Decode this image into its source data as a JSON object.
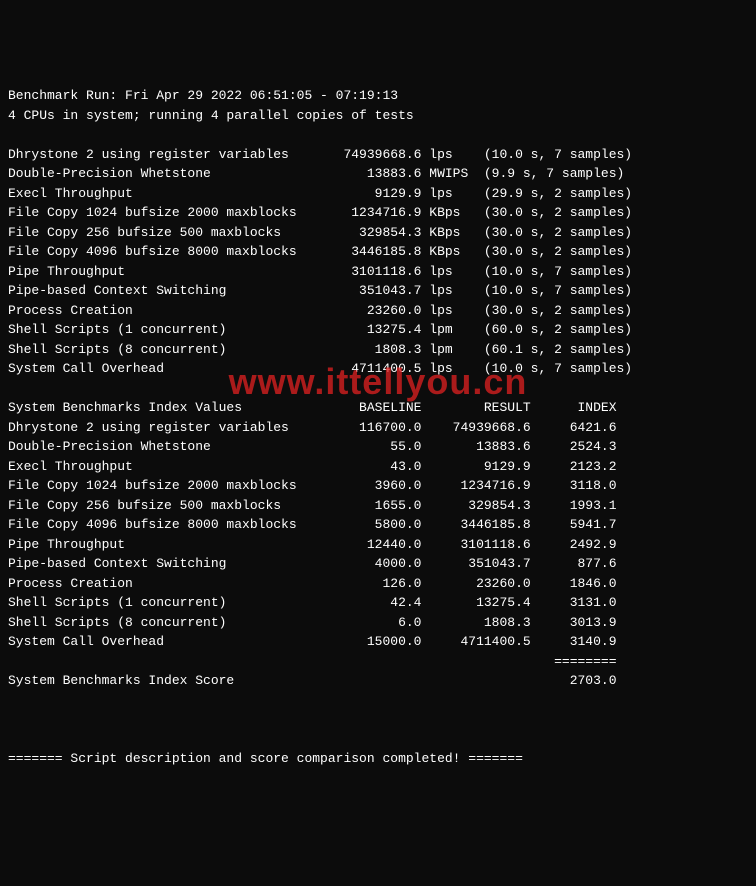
{
  "header": {
    "run_line": "Benchmark Run: Fri Apr 29 2022 06:51:05 - 07:19:13",
    "cpu_line": "4 CPUs in system; running 4 parallel copies of tests"
  },
  "raw": [
    {
      "name": "Dhrystone 2 using register variables",
      "value": "74939668.6",
      "unit": "lps",
      "time": "10.0",
      "samples": "7"
    },
    {
      "name": "Double-Precision Whetstone",
      "value": "13883.6",
      "unit": "MWIPS",
      "time": "9.9",
      "samples": "7"
    },
    {
      "name": "Execl Throughput",
      "value": "9129.9",
      "unit": "lps",
      "time": "29.9",
      "samples": "2"
    },
    {
      "name": "File Copy 1024 bufsize 2000 maxblocks",
      "value": "1234716.9",
      "unit": "KBps",
      "time": "30.0",
      "samples": "2"
    },
    {
      "name": "File Copy 256 bufsize 500 maxblocks",
      "value": "329854.3",
      "unit": "KBps",
      "time": "30.0",
      "samples": "2"
    },
    {
      "name": "File Copy 4096 bufsize 8000 maxblocks",
      "value": "3446185.8",
      "unit": "KBps",
      "time": "30.0",
      "samples": "2"
    },
    {
      "name": "Pipe Throughput",
      "value": "3101118.6",
      "unit": "lps",
      "time": "10.0",
      "samples": "7"
    },
    {
      "name": "Pipe-based Context Switching",
      "value": "351043.7",
      "unit": "lps",
      "time": "10.0",
      "samples": "7"
    },
    {
      "name": "Process Creation",
      "value": "23260.0",
      "unit": "lps",
      "time": "30.0",
      "samples": "2"
    },
    {
      "name": "Shell Scripts (1 concurrent)",
      "value": "13275.4",
      "unit": "lpm",
      "time": "60.0",
      "samples": "2"
    },
    {
      "name": "Shell Scripts (8 concurrent)",
      "value": "1808.3",
      "unit": "lpm",
      "time": "60.1",
      "samples": "2"
    },
    {
      "name": "System Call Overhead",
      "value": "4711400.5",
      "unit": "lps",
      "time": "10.0",
      "samples": "7"
    }
  ],
  "index_header": {
    "label": "System Benchmarks Index Values",
    "c1": "BASELINE",
    "c2": "RESULT",
    "c3": "INDEX"
  },
  "index": [
    {
      "name": "Dhrystone 2 using register variables",
      "baseline": "116700.0",
      "result": "74939668.6",
      "idx": "6421.6"
    },
    {
      "name": "Double-Precision Whetstone",
      "baseline": "55.0",
      "result": "13883.6",
      "idx": "2524.3"
    },
    {
      "name": "Execl Throughput",
      "baseline": "43.0",
      "result": "9129.9",
      "idx": "2123.2"
    },
    {
      "name": "File Copy 1024 bufsize 2000 maxblocks",
      "baseline": "3960.0",
      "result": "1234716.9",
      "idx": "3118.0"
    },
    {
      "name": "File Copy 256 bufsize 500 maxblocks",
      "baseline": "1655.0",
      "result": "329854.3",
      "idx": "1993.1"
    },
    {
      "name": "File Copy 4096 bufsize 8000 maxblocks",
      "baseline": "5800.0",
      "result": "3446185.8",
      "idx": "5941.7"
    },
    {
      "name": "Pipe Throughput",
      "baseline": "12440.0",
      "result": "3101118.6",
      "idx": "2492.9"
    },
    {
      "name": "Pipe-based Context Switching",
      "baseline": "4000.0",
      "result": "351043.7",
      "idx": "877.6"
    },
    {
      "name": "Process Creation",
      "baseline": "126.0",
      "result": "23260.0",
      "idx": "1846.0"
    },
    {
      "name": "Shell Scripts (1 concurrent)",
      "baseline": "42.4",
      "result": "13275.4",
      "idx": "3131.0"
    },
    {
      "name": "Shell Scripts (8 concurrent)",
      "baseline": "6.0",
      "result": "1808.3",
      "idx": "3013.9"
    },
    {
      "name": "System Call Overhead",
      "baseline": "15000.0",
      "result": "4711400.5",
      "idx": "3140.9"
    }
  ],
  "score": {
    "label": "System Benchmarks Index Score",
    "value": "2703.0",
    "rule": "========"
  },
  "footer": "======= Script description and score comparison completed! =======",
  "watermark": "www.ittellyou.cn"
}
